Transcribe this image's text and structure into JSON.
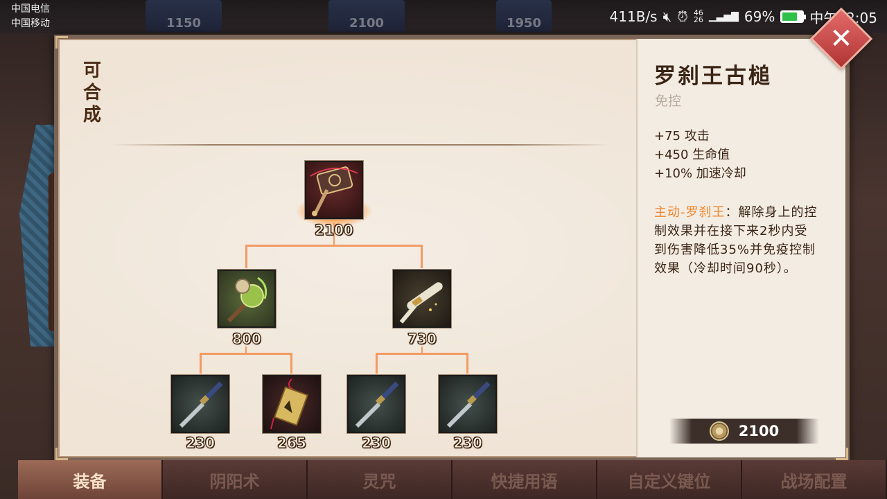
{
  "status_bar": {
    "carrier1": "中国电信",
    "carrier2": "中国移动",
    "net_speed": "411B/s",
    "mute_icon": "mute-icon",
    "alarm_icon": "alarm-icon",
    "signal1": "46\n26",
    "signal2": "26",
    "battery": "69%",
    "time": "中午12:05"
  },
  "background": {
    "tile1": "1150",
    "tile2": "2100",
    "tile3": "1950"
  },
  "panel": {
    "craft_label": "可合成",
    "close_icon": "close-icon"
  },
  "tree": {
    "root": {
      "name": "罗刹王古槌",
      "price": "2100"
    },
    "mid": [
      {
        "price": "800"
      },
      {
        "price": "730"
      }
    ],
    "leaves": [
      {
        "price": "230"
      },
      {
        "price": "265"
      },
      {
        "price": "230"
      },
      {
        "price": "230"
      }
    ]
  },
  "info": {
    "name": "罗刹王古槌",
    "tag": "免控",
    "stats": [
      "+75 攻击",
      "+450 生命值",
      "+10% 加速冷却"
    ],
    "active_label": "主动-罗刹王",
    "active_sep": "：",
    "description": "解除身上的控制效果并在接下来2秒内受到伤害降低35%并免疫控制效果（冷却时间90秒）。",
    "price": "2100"
  },
  "tabs": [
    "装备",
    "阴阳术",
    "灵咒",
    "快捷用语",
    "自定义键位",
    "战场配置"
  ],
  "active_tab": 0,
  "colors": {
    "accent_orange": "#f0842a",
    "tree_line": "#f39a62",
    "panel_bg": "#efe4d6"
  }
}
